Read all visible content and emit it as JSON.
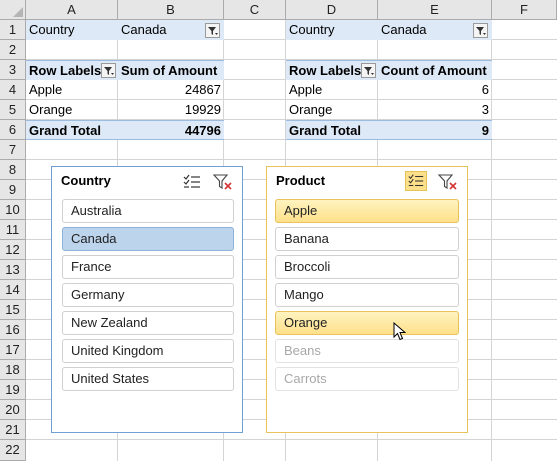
{
  "columns": [
    "A",
    "B",
    "C",
    "D",
    "E",
    "F"
  ],
  "rows": [
    "1",
    "2",
    "3",
    "4",
    "5",
    "6",
    "7",
    "8",
    "9",
    "10",
    "11",
    "12",
    "13",
    "14",
    "15",
    "16",
    "17",
    "18",
    "19",
    "20",
    "21",
    "22"
  ],
  "pivot1": {
    "filter_label": "Country",
    "filter_value": "Canada",
    "row_labels": "Row Labels",
    "value_header": "Sum of Amount",
    "rows": [
      {
        "label": "Apple",
        "value": "24867"
      },
      {
        "label": "Orange",
        "value": "19929"
      }
    ],
    "total_label": "Grand Total",
    "total_value": "44796"
  },
  "pivot2": {
    "filter_label": "Country",
    "filter_value": "Canada",
    "row_labels": "Row Labels",
    "value_header": "Count of Amount",
    "rows": [
      {
        "label": "Apple",
        "value": "6"
      },
      {
        "label": "Orange",
        "value": "3"
      }
    ],
    "total_label": "Grand Total",
    "total_value": "9"
  },
  "slicer_country": {
    "title": "Country",
    "items": [
      "Australia",
      "Canada",
      "France",
      "Germany",
      "New Zealand",
      "United Kingdom",
      "United States"
    ],
    "selected": "Canada",
    "accent": "#bcd4ec"
  },
  "slicer_product": {
    "title": "Product",
    "items": [
      "Apple",
      "Banana",
      "Broccoli",
      "Mango",
      "Orange",
      "Beans",
      "Carrots"
    ],
    "selected": [
      "Apple",
      "Orange"
    ],
    "disabled": [
      "Beans",
      "Carrots"
    ],
    "accent": "#fde08a"
  },
  "icons": [
    "multi-select-icon",
    "clear-filter-icon",
    "filter-dropdown-icon",
    "mouse-cursor-icon"
  ]
}
